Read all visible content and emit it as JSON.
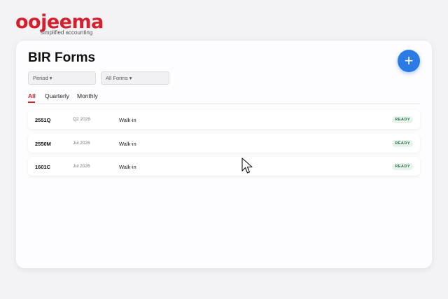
{
  "brand": {
    "name": "oojeema",
    "tagline": "simplified accounting",
    "color": "#d61f2c"
  },
  "page": {
    "title": "BIR Forms",
    "add_button_icon": "plus-icon",
    "accent": "#2c7be5"
  },
  "filters": {
    "period_label": "Period ▾",
    "forms_label": "All Forms ▾"
  },
  "tabs": [
    {
      "label": "All",
      "active": true
    },
    {
      "label": "Quarterly",
      "active": false
    },
    {
      "label": "Monthly",
      "active": false
    }
  ],
  "rows": [
    {
      "form": "2551Q",
      "period": "Q2 2026",
      "client": "Walk-in",
      "status": "READY"
    },
    {
      "form": "2550M",
      "period": "Jul 2026",
      "client": "Walk-in",
      "status": "READY"
    },
    {
      "form": "1601C",
      "period": "Jul 2026",
      "client": "Walk-in",
      "status": "READY"
    }
  ],
  "status_colors": {
    "ready_bg": "#e6f3ea",
    "ready_text": "#2d6e43"
  }
}
